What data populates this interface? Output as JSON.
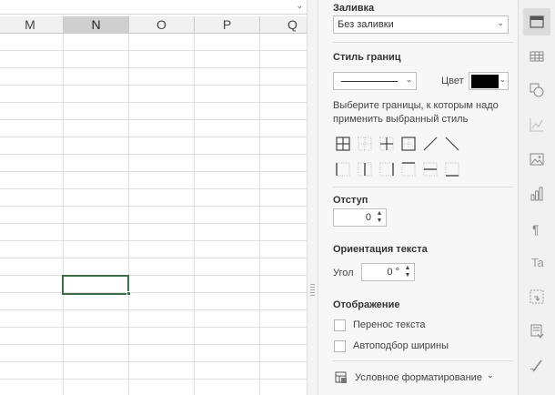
{
  "sheet": {
    "columns": [
      {
        "label": "M",
        "active": false
      },
      {
        "label": "N",
        "active": true
      },
      {
        "label": "O",
        "active": false
      },
      {
        "label": "P",
        "active": false
      },
      {
        "label": "Q",
        "active": false
      }
    ]
  },
  "panel": {
    "fill": {
      "title": "Заливка",
      "value": "Без заливки"
    },
    "border_style": {
      "title": "Стиль границ",
      "color_label": "Цвет",
      "color": "#000000",
      "instruction": "Выберите границы, к которым надо применить выбранный стиль",
      "buttons": [
        "all-borders-icon",
        "inner-borders-icon",
        "inner-cross-icon",
        "outer-border-icon",
        "diagonal-up-icon",
        "diagonal-down-icon",
        "left-border-icon",
        "inner-vertical-icon",
        "right-border-icon",
        "top-border-icon",
        "inner-horizontal-icon",
        "bottom-border-icon"
      ]
    },
    "indent": {
      "title": "Отступ",
      "value": "0"
    },
    "orientation": {
      "title": "Ориентация текста",
      "angle_label": "Угол",
      "angle_value": "0 °"
    },
    "display": {
      "title": "Отображение",
      "wrap_text": "Перенос текста",
      "wrap_checked": false,
      "autofit": "Автоподбор ширины",
      "autofit_checked": false
    },
    "conditional_formatting": "Условное форматирование"
  },
  "toolbar": {
    "tools": [
      {
        "icon": "cell-settings-icon",
        "active": true
      },
      {
        "icon": "table-icon",
        "active": false
      },
      {
        "icon": "shape-icon",
        "active": false
      },
      {
        "icon": "chart-icon",
        "active": false
      },
      {
        "icon": "image-icon",
        "active": false
      },
      {
        "icon": "bar-chart-icon",
        "active": false
      },
      {
        "icon": "paragraph-icon",
        "active": false
      },
      {
        "icon": "text-art-icon",
        "active": false
      },
      {
        "icon": "pivot-table-icon",
        "active": false
      },
      {
        "icon": "slicer-icon",
        "active": false
      },
      {
        "icon": "signature-icon",
        "active": false
      }
    ]
  }
}
